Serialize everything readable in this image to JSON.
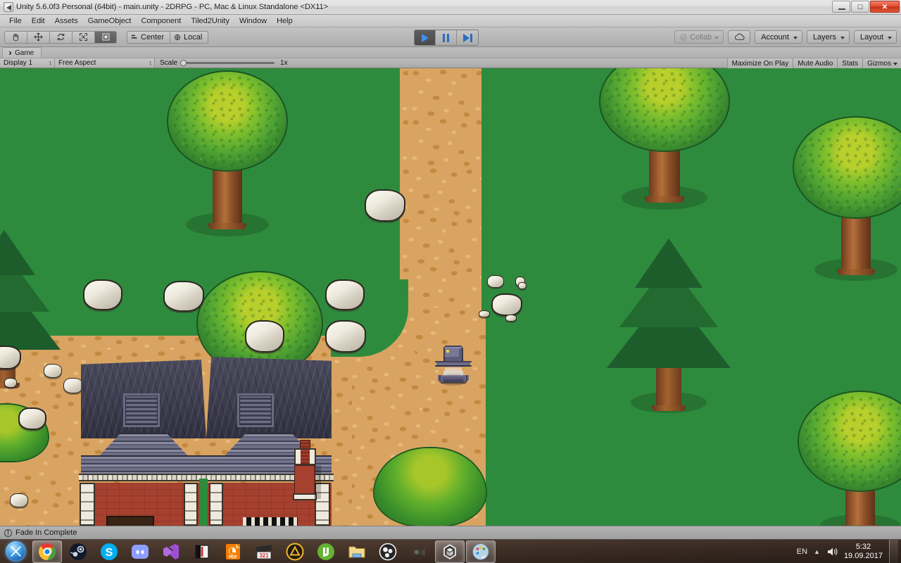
{
  "window": {
    "title": "Unity 5.6.0f3 Personal (64bit) - main.unity - 2DRPG - PC, Mac & Linux Standalone <DX11>",
    "app_icon": "unity-icon",
    "minimize_label": "–",
    "restore_label": "❐",
    "close_label": "✕"
  },
  "menu": {
    "items": [
      {
        "label": "File"
      },
      {
        "label": "Edit"
      },
      {
        "label": "Assets"
      },
      {
        "label": "GameObject"
      },
      {
        "label": "Component"
      },
      {
        "label": "Tiled2Unity"
      },
      {
        "label": "Window"
      },
      {
        "label": "Help"
      }
    ]
  },
  "toolbar": {
    "tools": [
      {
        "name": "hand-tool",
        "active": false
      },
      {
        "name": "move-tool",
        "active": false
      },
      {
        "name": "rotate-tool",
        "active": false
      },
      {
        "name": "scale-tool",
        "active": false
      },
      {
        "name": "rect-tool",
        "active": true
      }
    ],
    "pivot_label": "Center",
    "space_label": "Local",
    "play_label": "Play",
    "pause_label": "Pause",
    "step_label": "Step",
    "play_active": true,
    "collab_label": "Collab",
    "cloud_label": "Services",
    "account_label": "Account",
    "layers_label": "Layers",
    "layout_label": "Layout"
  },
  "game_panel": {
    "tab_label": "Game",
    "display_label": "Display 1",
    "aspect_label": "Free Aspect",
    "scale_label": "Scale",
    "scale_value": "1x",
    "maximize_label": "Maximize On Play",
    "mute_label": "Mute Audio",
    "stats_label": "Stats",
    "gizmos_label": "Gizmos"
  },
  "status": {
    "icon": "info-icon",
    "message": "Fade In Complete"
  },
  "scene": {
    "colors": {
      "grass": "#2e8b3d",
      "dirt": "#d9a461",
      "dirt_dark": "#c4893f",
      "rock": "#f2eee2",
      "roof": "#3c3c4e",
      "brick": "#a6402f",
      "trunk": "#96572b",
      "pine": "#1e5c2c"
    },
    "objects": {
      "player_name": "wizard-player-character",
      "house_name": "house-building",
      "chimney_name": "chimney-object"
    }
  },
  "taskbar": {
    "start_label": "Start",
    "items": [
      {
        "name": "chrome-icon",
        "label": "Google Chrome",
        "active": true
      },
      {
        "name": "steam-icon",
        "label": "Steam",
        "active": false
      },
      {
        "name": "skype-icon",
        "label": "Skype",
        "active": false
      },
      {
        "name": "discord-icon",
        "label": "Discord",
        "active": false
      },
      {
        "name": "purple-app-icon",
        "label": "Visual Studio",
        "active": false
      },
      {
        "name": "book-app-icon",
        "label": "Reader",
        "active": false
      },
      {
        "name": "pdf-icon",
        "label": "PDF Reader",
        "active": false
      },
      {
        "name": "media-player-icon",
        "label": "Media Player Classic",
        "active": false
      },
      {
        "name": "triangle-app-icon",
        "label": "Aimp",
        "active": false
      },
      {
        "name": "utorrent-icon",
        "label": "uTorrent",
        "active": false
      },
      {
        "name": "folder-icon",
        "label": "File Explorer",
        "active": false
      },
      {
        "name": "obs-icon",
        "label": "OBS Studio",
        "active": false
      },
      {
        "name": "camera-icon",
        "label": "Camera Tool",
        "active": false
      },
      {
        "name": "unity-taskbar-icon",
        "label": "Unity",
        "active": true
      },
      {
        "name": "paint-icon",
        "label": "Paint",
        "active": true
      }
    ],
    "tray": {
      "language": "EN",
      "volume_icon": "volume-icon",
      "show_hidden_icon": "chevron-up-icon",
      "time": "5:32",
      "date": "19.09.2017"
    }
  }
}
